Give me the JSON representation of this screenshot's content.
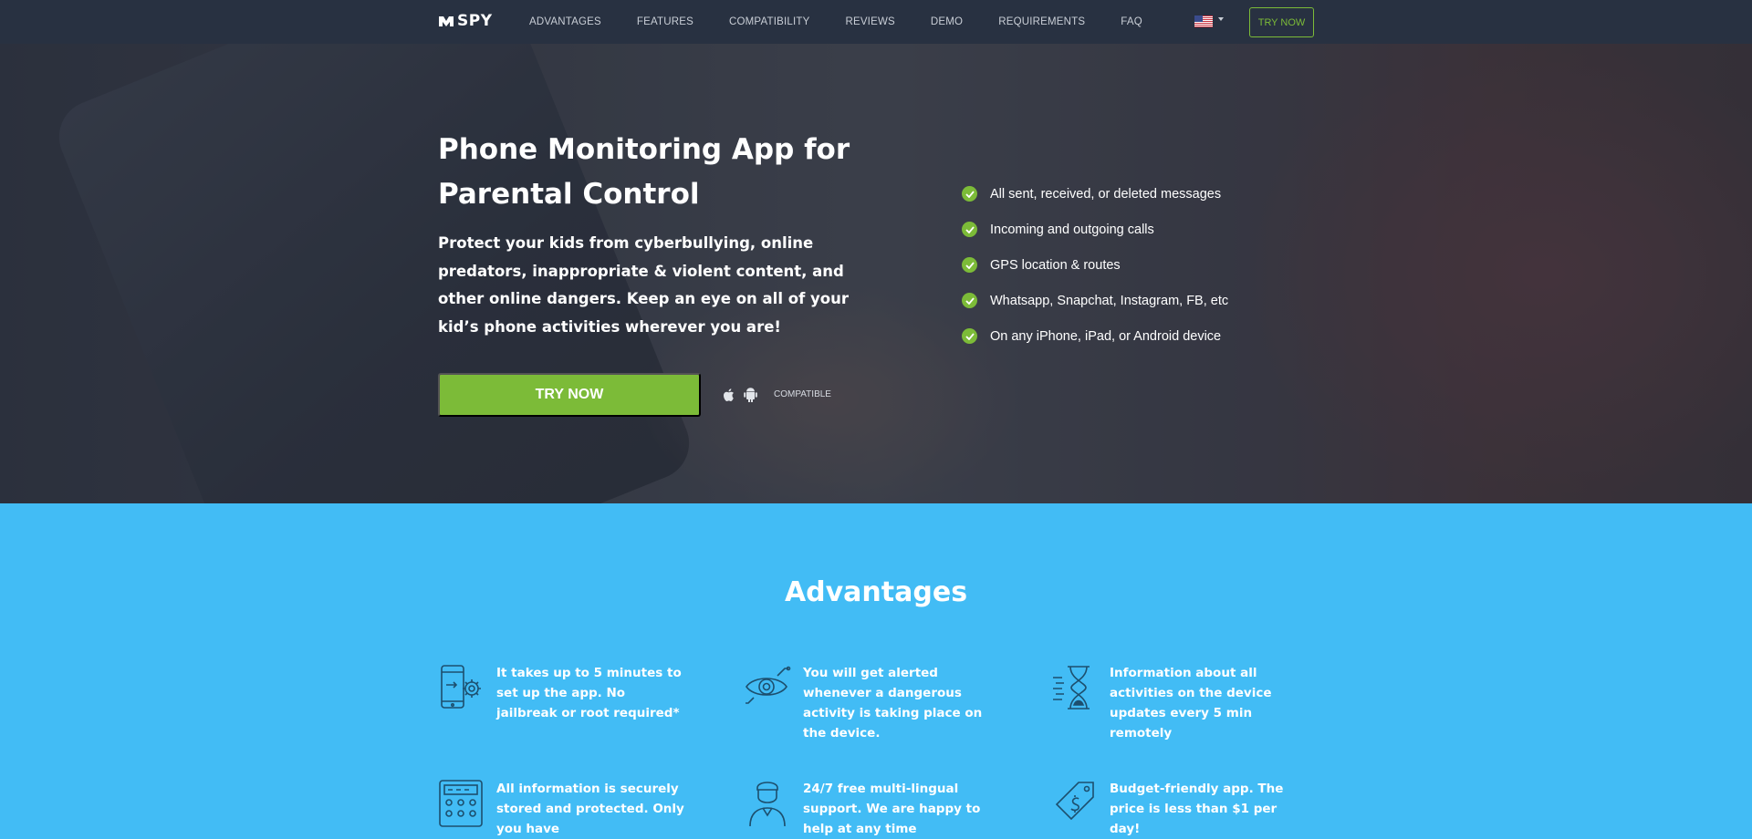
{
  "header": {
    "logo_text": "SPY",
    "nav": [
      "ADVANTAGES",
      "FEATURES",
      "COMPATIBILITY",
      "REVIEWS",
      "DEMO",
      "REQUIREMENTS",
      "FAQ"
    ],
    "try_now": "TRY NOW"
  },
  "hero": {
    "title": "Phone Monitoring App for Parental Control",
    "subtitle": "Protect your kids from cyberbullying, online predators, inappropriate & violent content, and other online dangers. Keep an eye on all of your kid’s phone activities wherever you are!",
    "cta": "TRY NOW",
    "compatible": "COMPATIBLE",
    "features": [
      "All sent, received, or deleted messages",
      "Incoming and outgoing calls",
      "GPS location & routes",
      "Whatsapp, Snapchat, Instagram, FB, etc",
      "On any iPhone, iPad, or Android device"
    ]
  },
  "advantages": {
    "title": "Advantages",
    "items": [
      "It takes up to 5 minutes to set up the app. No jailbreak or root required*",
      "You will get alerted whenever a dangerous activity is taking place on the device.",
      "Information about all activities on the device updates every 5 min remotely",
      "All information is securely stored and protected. Only you have",
      "24/7 free multi-lingual support. We are happy to help at any time",
      "Budget-friendly app. The price is less than $1 per day!"
    ]
  },
  "colors": {
    "header_bg": "#283141",
    "accent_green": "#7cbb38",
    "section_blue": "#42bcf5"
  }
}
